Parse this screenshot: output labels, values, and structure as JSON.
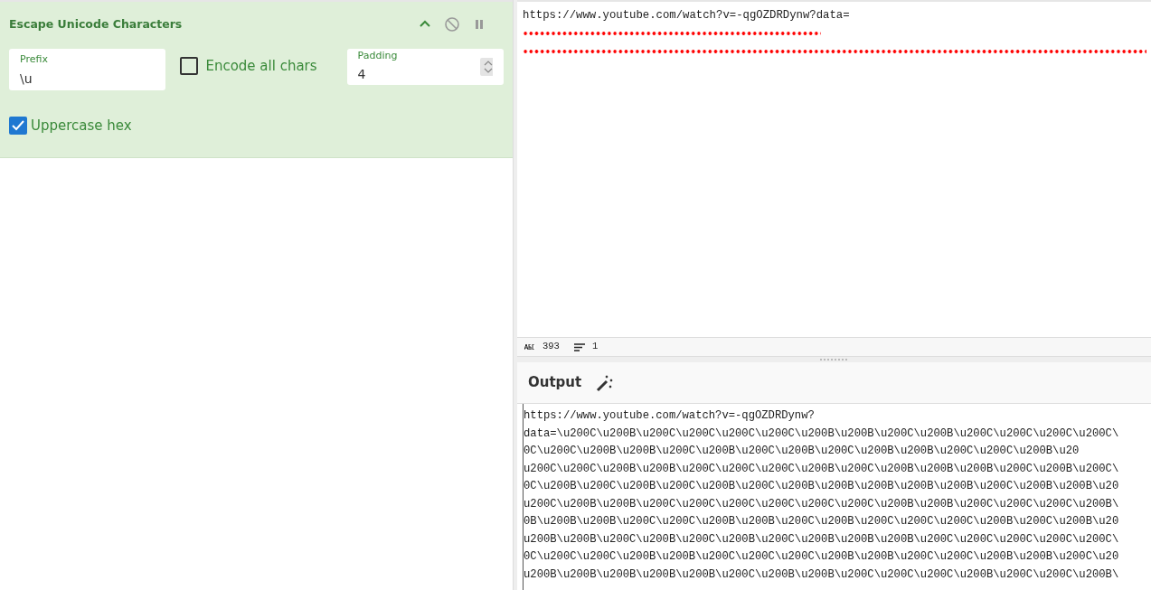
{
  "operation": {
    "title": "Escape Unicode Characters",
    "controls": [
      {
        "kind": "collapse"
      },
      {
        "kind": "disable"
      },
      {
        "kind": "pause"
      }
    ],
    "prefix": {
      "label": "Prefix",
      "value": "\\u"
    },
    "encode_all": {
      "label": "Encode all chars",
      "checked": false
    },
    "padding": {
      "label": "Padding",
      "value": "4"
    },
    "uppercase_hex": {
      "label": "Uppercase hex",
      "checked": true
    }
  },
  "input": {
    "text": "https://www.youtube.com/watch?v=-qgOZDRDynw?data=",
    "status": {
      "length": "393",
      "lines": "1"
    }
  },
  "output": {
    "title": "Output",
    "lines": [
      "https://www.youtube.com/watch?v=-qgOZDRDynw?",
      "data=\\u200C\\u200B\\u200C\\u200C\\u200C\\u200C\\u200B\\u200B\\u200C\\u200B\\u200C\\u200C\\u200C\\u200C\\",
      "0C\\u200C\\u200B\\u200B\\u200C\\u200B\\u200C\\u200B\\u200C\\u200B\\u200B\\u200C\\u200C\\u200B\\u20",
      "u200C\\u200C\\u200B\\u200B\\u200C\\u200C\\u200C\\u200B\\u200C\\u200B\\u200B\\u200B\\u200C\\u200B\\u200C\\",
      "0C\\u200B\\u200C\\u200B\\u200C\\u200B\\u200C\\u200B\\u200B\\u200B\\u200B\\u200B\\u200C\\u200B\\u200B\\u20",
      "u200C\\u200B\\u200B\\u200C\\u200C\\u200C\\u200C\\u200C\\u200C\\u200B\\u200B\\u200C\\u200C\\u200C\\u200B\\",
      "0B\\u200B\\u200B\\u200C\\u200C\\u200B\\u200B\\u200C\\u200B\\u200C\\u200C\\u200C\\u200B\\u200C\\u200B\\u20",
      "u200B\\u200B\\u200C\\u200B\\u200C\\u200B\\u200C\\u200B\\u200B\\u200B\\u200C\\u200C\\u200C\\u200C\\u200C\\",
      "0C\\u200C\\u200C\\u200B\\u200B\\u200C\\u200C\\u200C\\u200B\\u200B\\u200C\\u200C\\u200B\\u200B\\u200C\\u20",
      "u200B\\u200B\\u200B\\u200B\\u200B\\u200C\\u200B\\u200B\\u200C\\u200C\\u200C\\u200B\\u200C\\u200C\\u200B\\"
    ]
  }
}
